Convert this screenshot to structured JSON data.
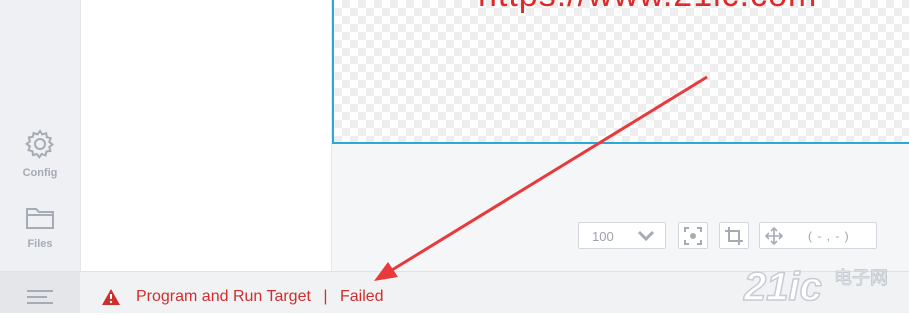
{
  "sidebar": {
    "items": [
      {
        "label": "Config",
        "icon": "gear-icon"
      },
      {
        "label": "Files",
        "icon": "folder-icon"
      }
    ]
  },
  "canvas": {
    "overlay_text": "https://www.21ic.com"
  },
  "toolbar": {
    "zoom_value": "100",
    "coords_value": "( - , - )"
  },
  "status": {
    "message": "Program and Run Target",
    "separator": "|",
    "result": "Failed",
    "color": "#d02e2e"
  },
  "watermark": {
    "brand": "21ic",
    "chinese": "电子网"
  },
  "colors": {
    "accent": "#2ba9d6",
    "error": "#d02e2e",
    "annotation_arrow": "#e8393c"
  }
}
